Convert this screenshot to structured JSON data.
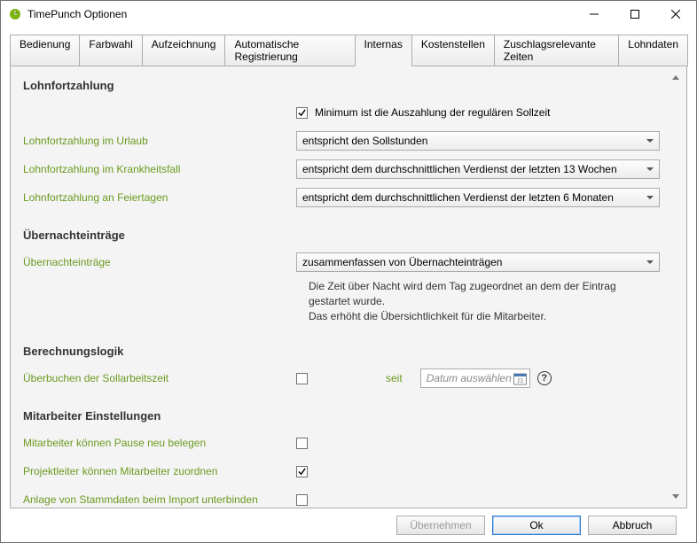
{
  "window": {
    "title": "TimePunch Optionen"
  },
  "tabs": [
    {
      "label": "Bedienung"
    },
    {
      "label": "Farbwahl"
    },
    {
      "label": "Aufzeichnung"
    },
    {
      "label": "Automatische Registrierung"
    },
    {
      "label": "Internas"
    },
    {
      "label": "Kostenstellen"
    },
    {
      "label": "Zuschlagsrelevante Zeiten"
    },
    {
      "label": "Lohndaten"
    }
  ],
  "active_tab_index": 4,
  "sections": {
    "lohnfortzahlung": {
      "heading": "Lohnfortzahlung",
      "minimum_label": "Minimum ist die Auszahlung der regulären Sollzeit",
      "minimum_checked": true,
      "urlaub_label": "Lohnfortzahlung im Urlaub",
      "urlaub_value": "entspricht den Sollstunden",
      "krank_label": "Lohnfortzahlung im Krankheitsfall",
      "krank_value": "entspricht dem durchschnittlichen Verdienst der letzten 13 Wochen",
      "feiertag_label": "Lohnfortzahlung an Feiertagen",
      "feiertag_value": "entspricht dem durchschnittlichen Verdienst der letzten 6 Monaten"
    },
    "uebernacht": {
      "heading": "Übernachteinträge",
      "label": "Übernachteinträge",
      "value": "zusammenfassen von Übernachteinträgen",
      "hint1": "Die Zeit über Nacht wird dem Tag zugeordnet an dem der Eintrag gestartet wurde.",
      "hint2": "Das erhöht die Übersichtlichkeit für die Mitarbeiter."
    },
    "berechnung": {
      "heading": "Berechnungslogik",
      "ueberbuchen_label": "Überbuchen der Sollarbeitszeit",
      "ueberbuchen_checked": false,
      "seit_label": "seit",
      "date_placeholder": "Datum auswählen"
    },
    "mitarbeiter": {
      "heading": "Mitarbeiter Einstellungen",
      "pause_label": "Mitarbeiter können Pause neu belegen",
      "pause_checked": false,
      "projektleiter_label": "Projektleiter können Mitarbeiter zuordnen",
      "projektleiter_checked": true,
      "stammdaten_label": "Anlage von Stammdaten beim Import unterbinden",
      "stammdaten_checked": false
    }
  },
  "footer": {
    "apply": "Übernehmen",
    "ok": "Ok",
    "cancel": "Abbruch"
  },
  "icons": {
    "calendar_day": "15"
  }
}
